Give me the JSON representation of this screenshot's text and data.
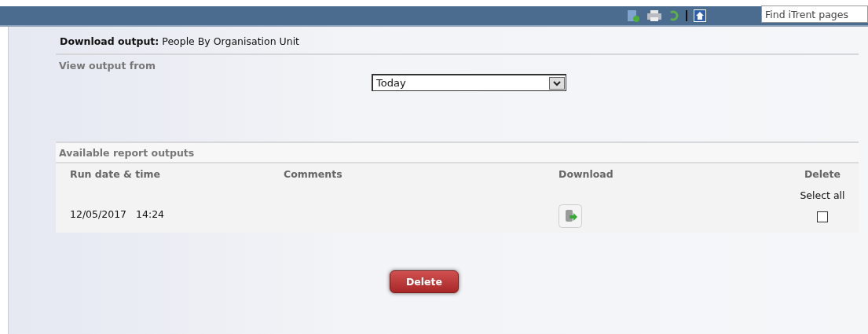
{
  "header": {
    "search": {
      "placeholder": "Find iTrent pages"
    }
  },
  "title": {
    "label": "Download output:",
    "value": "People By Organisation Unit"
  },
  "filter": {
    "label": "View output from",
    "value": "Today"
  },
  "outputs": {
    "heading": "Available report outputs",
    "columns": [
      "Run date & time",
      "Comments",
      "Download",
      "Delete"
    ],
    "select_all": "Select all",
    "rows": [
      {
        "date": "12/05/2017",
        "time": "14:24",
        "checked": false
      }
    ]
  },
  "delete_button": "Delete"
}
